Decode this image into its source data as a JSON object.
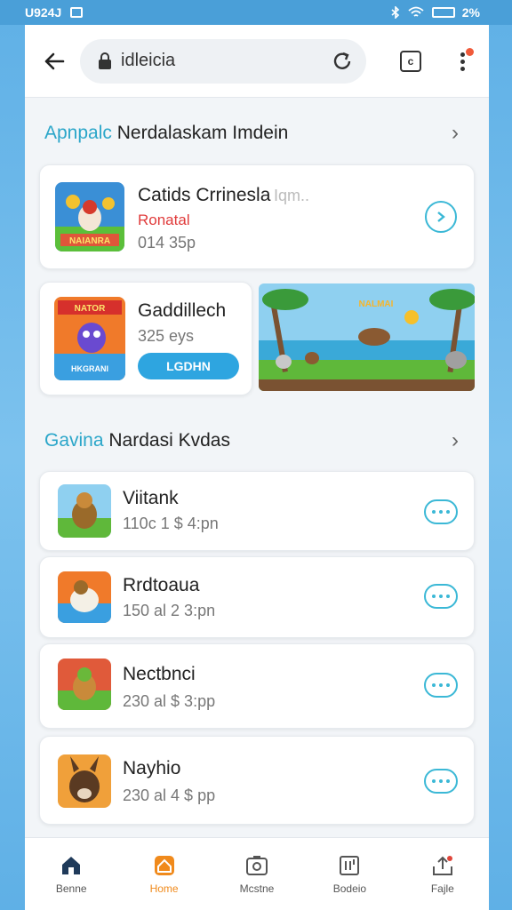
{
  "status": {
    "time": "U924J",
    "battery": "2%"
  },
  "browser": {
    "url": "idleicia"
  },
  "section1": {
    "prefix": "Apnpalc",
    "title": "Nerdalaskam Imdein"
  },
  "featured": {
    "title": "Catids Crrinesla",
    "title_suffix": " Iqm..",
    "tag": "Ronatal",
    "meta": "014 35p"
  },
  "promo": {
    "title": "Gaddillech",
    "meta": "325 eys",
    "button": "LGDHN"
  },
  "section2": {
    "prefix": "Gavina",
    "title": "Nardasi Kvdas"
  },
  "apps": [
    {
      "name": "Viitank",
      "meta": "110c 1 $ 4:pn"
    },
    {
      "name": "Rrdtoaua",
      "meta": "150 al 2 3:pn"
    },
    {
      "name": "Nectbnci",
      "meta": "230 al $ 3:pp"
    },
    {
      "name": "Nayhio",
      "meta": "230 al 4 $ pp"
    }
  ],
  "nav": [
    {
      "label": "Benne",
      "icon": "home-icon"
    },
    {
      "label": "Home",
      "icon": "home-icon"
    },
    {
      "label": "Mcstne",
      "icon": "camera-icon"
    },
    {
      "label": "Bodeio",
      "icon": "library-icon"
    },
    {
      "label": "Fajle",
      "icon": "share-icon"
    }
  ],
  "colors": {
    "accent": "#3bb8d6",
    "active_nav": "#f08a1c",
    "button": "#2ea5e0"
  }
}
